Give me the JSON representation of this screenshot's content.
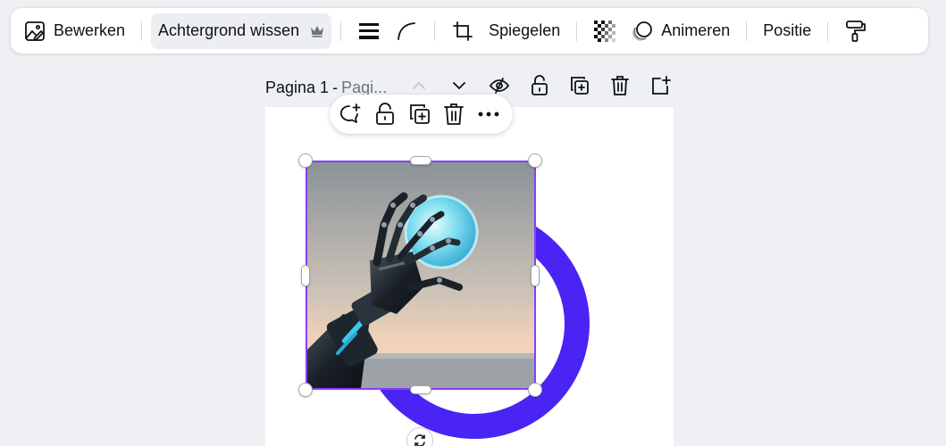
{
  "toolbar": {
    "edit_label": "Bewerken",
    "bg_remove_label": "Achtergrond wissen",
    "flip_label": "Spiegelen",
    "animate_label": "Animeren",
    "position_label": "Positie"
  },
  "page_header": {
    "title": "Pagina 1",
    "separator": "-",
    "subtitle_placeholder": "Pagi..."
  },
  "image": {
    "alt": "Robotic hand holding a glowing sphere"
  },
  "colors": {
    "selection": "#8b3dff",
    "ring": "#4a24f4",
    "canvas_bg": "#eef0f3"
  },
  "icons": {
    "toolbar": [
      "image-edit-icon",
      "crown-icon",
      "border-style-icon",
      "corner-rounding-icon",
      "crop-icon",
      "transparency-icon",
      "animate-icon",
      "paint-roller-icon"
    ],
    "page_header": [
      "chevron-up-icon",
      "chevron-down-icon",
      "hide-eye-icon",
      "lock-icon",
      "duplicate-page-icon",
      "trash-icon",
      "add-page-icon"
    ],
    "context": [
      "comment-add-icon",
      "lock-icon",
      "duplicate-icon",
      "trash-icon",
      "more-icon"
    ]
  }
}
